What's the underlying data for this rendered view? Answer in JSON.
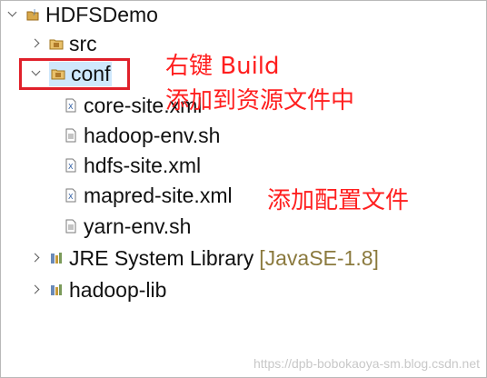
{
  "tree": {
    "project": {
      "label": "HDFSDemo",
      "icon": "java-project-icon"
    },
    "src": {
      "label": "src",
      "icon": "package-folder-icon"
    },
    "conf": {
      "label": "conf",
      "icon": "package-folder-icon"
    },
    "conf_files": [
      {
        "label": "core-site.xml",
        "icon": "xml-file-icon"
      },
      {
        "label": "hadoop-env.sh",
        "icon": "text-file-icon"
      },
      {
        "label": "hdfs-site.xml",
        "icon": "xml-file-icon"
      },
      {
        "label": "mapred-site.xml",
        "icon": "xml-file-icon"
      },
      {
        "label": "yarn-env.sh",
        "icon": "text-file-icon"
      }
    ],
    "jre": {
      "label": "JRE System Library",
      "suffix": "[JavaSE-1.8]",
      "icon": "library-icon"
    },
    "lib": {
      "label": "hadoop-lib",
      "icon": "library-icon"
    }
  },
  "annotations": {
    "build_line1": "右键 Build",
    "build_line2": "添加到资源文件中",
    "config_note": "添加配置文件"
  },
  "watermark": "https://dpb-bobokaoya-sm.blog.csdn.net",
  "colors": {
    "annotation_red": "#ff1f1f",
    "selection_blue": "#cfe8fc",
    "decoration_text": "#8b7a3e"
  }
}
